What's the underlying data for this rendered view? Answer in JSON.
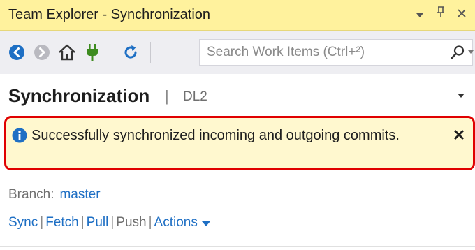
{
  "window": {
    "title": "Team Explorer - Synchronization"
  },
  "toolbar": {
    "search_placeholder": "Search Work Items (Ctrl+²)",
    "icons": [
      "back-icon",
      "forward-icon",
      "home-icon",
      "connect-icon",
      "refresh-icon"
    ]
  },
  "header": {
    "title": "Synchronization",
    "separator": "|",
    "repository": "DL2"
  },
  "notification": {
    "message": "Successfully synchronized incoming and outgoing commits.",
    "close_glyph": "✕"
  },
  "branch": {
    "label": "Branch:",
    "value": "master"
  },
  "actions": {
    "sync": "Sync",
    "fetch": "Fetch",
    "pull": "Pull",
    "push": "Push",
    "actions": "Actions",
    "separator": "|"
  },
  "colors": {
    "title_bar": "#fff29d",
    "toolbar": "#eeeef2",
    "link": "#1e6fc4",
    "notice_bg": "#fff8cf",
    "notice_border": "#e00000"
  }
}
